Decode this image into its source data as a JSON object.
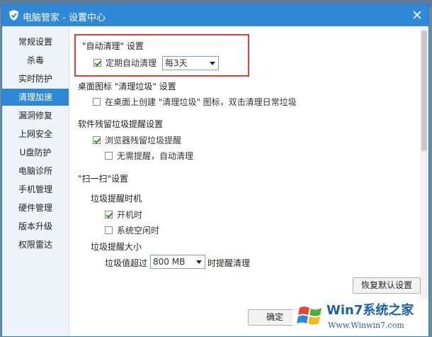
{
  "window": {
    "title": "电脑管家 - 设置中心"
  },
  "sidebar": {
    "items": [
      {
        "label": "常规设置"
      },
      {
        "label": "杀毒"
      },
      {
        "label": "实时防护"
      },
      {
        "label": "清理加速"
      },
      {
        "label": "漏洞修复"
      },
      {
        "label": "上网安全"
      },
      {
        "label": "U盘防护"
      },
      {
        "label": "电脑诊所"
      },
      {
        "label": "手机管理"
      },
      {
        "label": "硬件管理"
      },
      {
        "label": "版本升级"
      },
      {
        "label": "权限雷达"
      }
    ],
    "active_index": 3
  },
  "auto_clean": {
    "heading": "\"自动清理\" 设置",
    "checkbox_label": "定期自动清理",
    "checked": true,
    "interval_value": "每3天"
  },
  "desktop_icon": {
    "heading": "桌面图标 \"清理垃圾\" 设置",
    "checkbox_label": "在桌面上创建 \"清理垃圾\" 图标，双击清理日常垃圾",
    "checked": false
  },
  "residual": {
    "heading": "软件残留垃圾提醒设置",
    "browser_label": "浏览器残留垃圾提醒",
    "browser_checked": true,
    "no_remind_label": "无需提醒，自动清理",
    "no_remind_checked": false
  },
  "scan": {
    "heading": "\"扫一扫\"设置",
    "timing_heading": "垃圾提醒时机",
    "boot_label": "开机时",
    "boot_checked": true,
    "idle_label": "系统空闲时",
    "idle_checked": false,
    "size_heading": "垃圾提醒大小",
    "size_prefix": "垃圾值超过",
    "size_value": "800 MB",
    "size_suffix": "时提醒清理"
  },
  "buttons": {
    "restore": "恢复默认设置",
    "ok": "确定"
  },
  "watermark": {
    "brand": "Win7系统之家",
    "url": "Www.Winwin7.com"
  },
  "colors": {
    "accent": "#2e8ad8",
    "highlight_box": "#e23b3b",
    "check": "#2c8a2c"
  }
}
